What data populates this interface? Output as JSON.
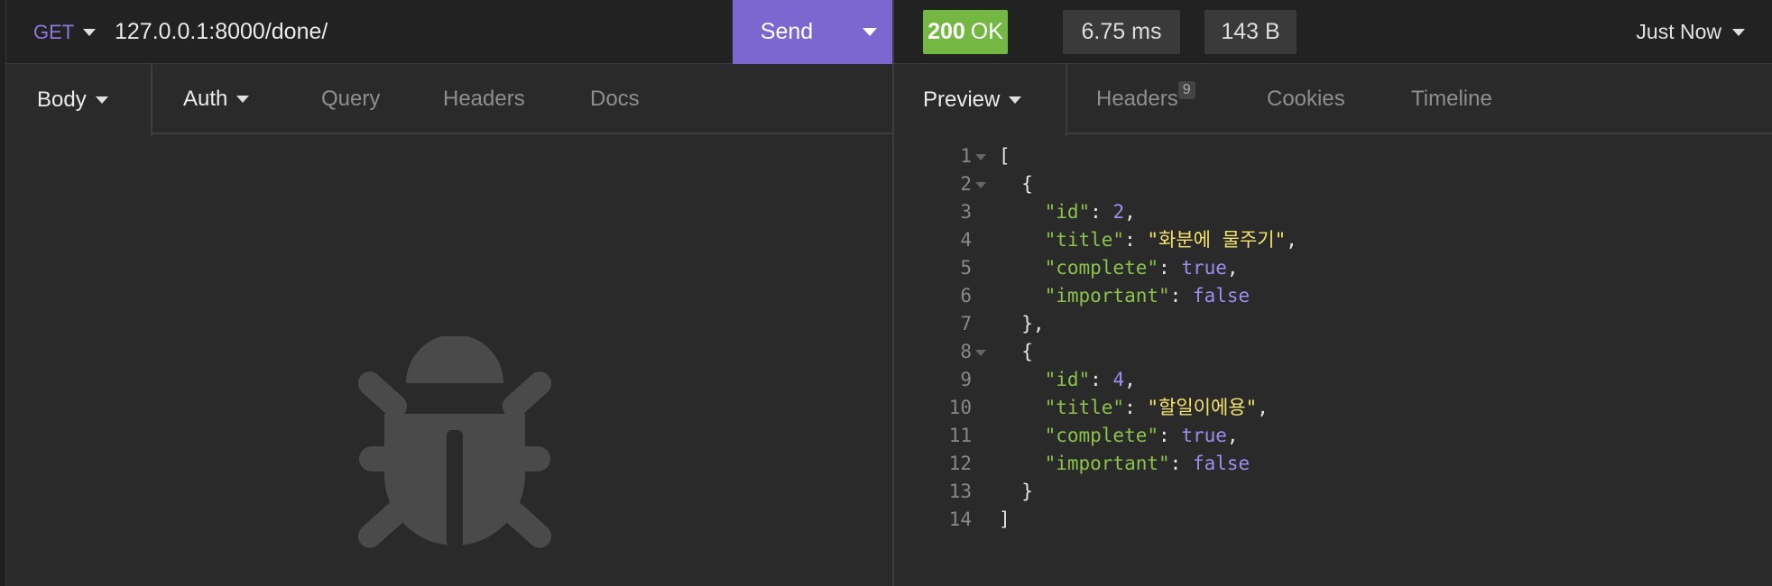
{
  "request": {
    "method": "GET",
    "url": "127.0.0.1:8000/done/",
    "send_label": "Send",
    "tabs": [
      {
        "label": "Body"
      },
      {
        "label": "Auth"
      },
      {
        "label": "Query"
      },
      {
        "label": "Headers"
      },
      {
        "label": "Docs"
      }
    ]
  },
  "response": {
    "status_code": "200",
    "status_text": "OK",
    "time": "6.75 ms",
    "size": "143 B",
    "history_label": "Just Now",
    "tabs": {
      "preview": "Preview",
      "headers": "Headers",
      "headers_count": "9",
      "cookies": "Cookies",
      "timeline": "Timeline"
    },
    "body_lines": [
      {
        "n": "1",
        "fold": true,
        "parts": [
          [
            "p",
            "["
          ]
        ]
      },
      {
        "n": "2",
        "fold": true,
        "parts": [
          [
            "p",
            "  {"
          ]
        ]
      },
      {
        "n": "3",
        "fold": false,
        "parts": [
          [
            "p",
            "    "
          ],
          [
            "k",
            "\"id\""
          ],
          [
            "p",
            ": "
          ],
          [
            "n",
            "2"
          ],
          [
            "p",
            ","
          ]
        ]
      },
      {
        "n": "4",
        "fold": false,
        "parts": [
          [
            "p",
            "    "
          ],
          [
            "k",
            "\"title\""
          ],
          [
            "p",
            ": "
          ],
          [
            "s",
            "\"화분에 물주기\""
          ],
          [
            "p",
            ","
          ]
        ]
      },
      {
        "n": "5",
        "fold": false,
        "parts": [
          [
            "p",
            "    "
          ],
          [
            "k",
            "\"complete\""
          ],
          [
            "p",
            ": "
          ],
          [
            "b",
            "true"
          ],
          [
            "p",
            ","
          ]
        ]
      },
      {
        "n": "6",
        "fold": false,
        "parts": [
          [
            "p",
            "    "
          ],
          [
            "k",
            "\"important\""
          ],
          [
            "p",
            ": "
          ],
          [
            "b",
            "false"
          ]
        ]
      },
      {
        "n": "7",
        "fold": false,
        "parts": [
          [
            "p",
            "  },"
          ]
        ]
      },
      {
        "n": "8",
        "fold": true,
        "parts": [
          [
            "p",
            "  {"
          ]
        ]
      },
      {
        "n": "9",
        "fold": false,
        "parts": [
          [
            "p",
            "    "
          ],
          [
            "k",
            "\"id\""
          ],
          [
            "p",
            ": "
          ],
          [
            "n",
            "4"
          ],
          [
            "p",
            ","
          ]
        ]
      },
      {
        "n": "10",
        "fold": false,
        "parts": [
          [
            "p",
            "    "
          ],
          [
            "k",
            "\"title\""
          ],
          [
            "p",
            ": "
          ],
          [
            "s",
            "\"할일이에용\""
          ],
          [
            "p",
            ","
          ]
        ]
      },
      {
        "n": "11",
        "fold": false,
        "parts": [
          [
            "p",
            "    "
          ],
          [
            "k",
            "\"complete\""
          ],
          [
            "p",
            ": "
          ],
          [
            "b",
            "true"
          ],
          [
            "p",
            ","
          ]
        ]
      },
      {
        "n": "12",
        "fold": false,
        "parts": [
          [
            "p",
            "    "
          ],
          [
            "k",
            "\"important\""
          ],
          [
            "p",
            ": "
          ],
          [
            "b",
            "false"
          ]
        ]
      },
      {
        "n": "13",
        "fold": false,
        "parts": [
          [
            "p",
            "  }"
          ]
        ]
      },
      {
        "n": "14",
        "fold": false,
        "parts": [
          [
            "p",
            "]"
          ]
        ]
      }
    ]
  },
  "colors": {
    "accent": "#7a67cf",
    "status_ok": "#75b743"
  },
  "icons": {
    "empty_state": "bug-icon"
  }
}
